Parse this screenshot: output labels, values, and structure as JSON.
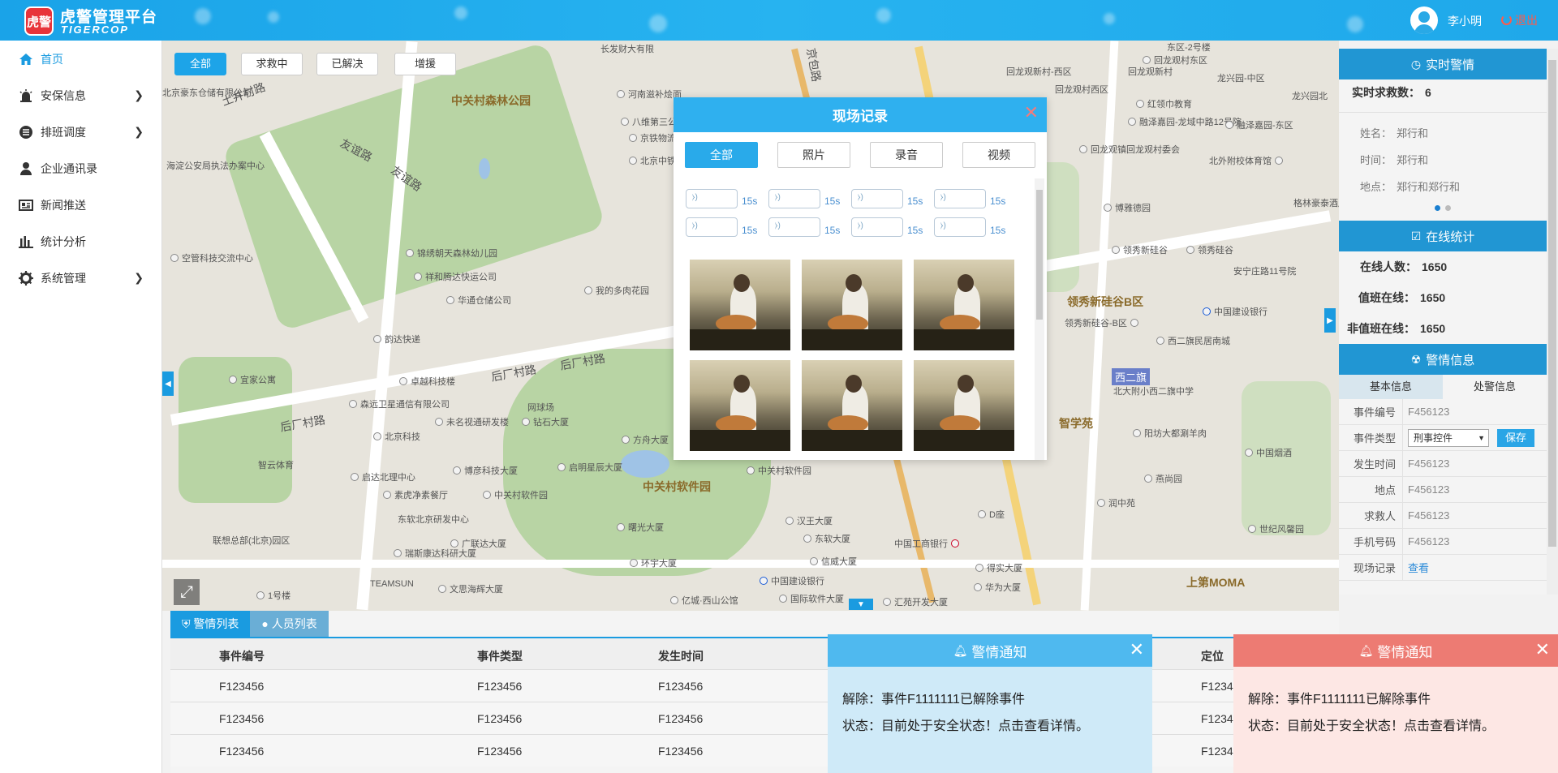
{
  "header": {
    "logo_text": "虎警",
    "title": "虎警管理平台",
    "subtitle": "TIGERCOP",
    "user_name": "李小明",
    "logout_label": "退出"
  },
  "sidebar": {
    "items": [
      {
        "label": "首页",
        "icon": "home-icon"
      },
      {
        "label": "安保信息",
        "icon": "siren-icon"
      },
      {
        "label": "排班调度",
        "icon": "schedule-icon"
      },
      {
        "label": "企业通讯录",
        "icon": "user-icon"
      },
      {
        "label": "新闻推送",
        "icon": "news-icon"
      },
      {
        "label": "统计分析",
        "icon": "bar-chart-icon"
      },
      {
        "label": "系统管理",
        "icon": "gear-icon"
      }
    ]
  },
  "map": {
    "filters": [
      "全部",
      "求救中",
      "已解决",
      "增援"
    ],
    "labels": {
      "l1": "中关村森林公园",
      "l2": "中关村软件园",
      "l3": "领秀新硅谷B区",
      "l4": "智学苑",
      "l5": "上第MOMA",
      "l6": "友谊路",
      "l7": "后厂村路",
      "l8": "西二旗",
      "l9": "河南滋补烩面",
      "l10": "八维第三公寓",
      "l11": "京铁物流有限公司",
      "l12": "北京中铁有限公司",
      "l13": "海淀公安局执法办案中心",
      "l14": "北京豪东仓储有限公司",
      "l15": "土井村路",
      "l16": "空管科技交流中心",
      "l17": "锦绣朝天森林幼儿园",
      "l18": "祥和腾达快运公司",
      "l19": "华通仓储公司",
      "l20": "我的多肉花园",
      "l21": "韵达快递",
      "l22": "宜家公寓",
      "l23": "卓越科技楼",
      "l24": "森远卫星通信有限公司",
      "l25": "北京科技",
      "l26": "未名视通研发楼",
      "l27": "钻石大厦",
      "l28": "网球场",
      "l29": "方舟大厦",
      "l30": "启明星辰大厦",
      "l31": "智云体育",
      "l32": "博彦科技大厦",
      "l33": "启达北理中心",
      "l34": "中关村软件园",
      "l35": "素虎净素餐厅",
      "l36": "东软北京研发中心",
      "l37": "广联达大厦",
      "l38": "联想总部(北京)园区",
      "l39": "瑞斯康达科研大厦",
      "l40": "TEAMSUN",
      "l41": "文思海辉大厦",
      "l42": "1号楼",
      "l43": "曙光大厦",
      "l44": "环宇大厦",
      "l45": "亿城·西山公馆",
      "l46": "中关村软件园",
      "l47": "汉王大厦",
      "l48": "东软大厦",
      "l49": "信威大厦",
      "l50": "中国建设银行",
      "l51": "国际软件大厦",
      "l52": "汇苑开发大厦",
      "l53": "中国工商银行",
      "l54": "D座",
      "l55": "得实大厦",
      "l56": "华为大厦",
      "l57": "回龙观新村-西区",
      "l58": "回龙观新村",
      "l59": "回龙观村西区",
      "l60": "回龙观村东区",
      "l61": "红领巾教育",
      "l62": "融泽嘉园-龙域中路12号院",
      "l63": "融泽嘉园-东区",
      "l64": "回龙观镇回龙观村委会",
      "l65": "北外附校体育馆",
      "l66": "博雅德园",
      "l67": "领秀新硅谷",
      "l68": "领秀硅谷",
      "l69": "安宁庄路11号院",
      "l70": "领秀新硅谷-B区",
      "l71": "中国建设银行",
      "l72": "西二旗民居南城",
      "l73": "北大附小西二旗中学",
      "l74": "阳坊大都涮羊肉",
      "l75": "中国烟酒",
      "l76": "燕尚园",
      "l77": "润中苑",
      "l78": "世纪风馨园",
      "l79": "龙兴园-中区",
      "l80": "龙兴园北",
      "l81": "格林豪泰酒店",
      "l82": "北京豪东",
      "l83": "友谊路",
      "l84": "后厂村路",
      "l85": "长发财大有限",
      "l86": "东区-2号楼",
      "l87": "京包路"
    }
  },
  "realtime": {
    "title": "实时警情",
    "count_label": "实时求救数：",
    "count": "6",
    "name_label": "姓名：",
    "name": "郑行和",
    "time_label": "时间：",
    "time": "郑行和",
    "place_label": "地点：",
    "place": "郑行和郑行和"
  },
  "online": {
    "title": "在线统计",
    "online_label": "在线人数：",
    "online": "1650",
    "duty_label": "值班在线：",
    "duty": "1650",
    "offduty_label": "非值班在线：",
    "offduty": "1650"
  },
  "alarm_info": {
    "title": "警情信息",
    "tab_basic": "基本信息",
    "tab_handle": "处警信息",
    "rows": [
      {
        "k": "事件编号",
        "v": "F456123"
      },
      {
        "k": "发生时间",
        "v": "F456123"
      },
      {
        "k": "地点",
        "v": "F456123"
      },
      {
        "k": "求救人",
        "v": "F456123"
      },
      {
        "k": "手机号码",
        "v": "F456123"
      }
    ],
    "type_label": "事件类型",
    "type_value": "刑事控件",
    "save_label": "保存",
    "record_label": "现场记录",
    "record_link": "查看"
  },
  "bottom": {
    "tab_alarm": "警情列表",
    "tab_people": "人员列表",
    "columns": [
      "事件编号",
      "事件类型",
      "发生时间",
      "定位"
    ],
    "rows": [
      [
        "F123456",
        "F123456",
        "F123456",
        "F1234"
      ],
      [
        "F123456",
        "F123456",
        "F123456",
        "F1234"
      ],
      [
        "F123456",
        "F123456",
        "F123456",
        "F1234"
      ]
    ]
  },
  "notifications": [
    {
      "title": "警情通知",
      "line1": "解除：事件F1111111已解除事件",
      "line2": "状态：目前处于安全状态！点击查看详情。"
    },
    {
      "title": "警情通知",
      "line1": "解除：事件F1111111已解除事件",
      "line2": "状态：目前处于安全状态！点击查看详情。"
    }
  ],
  "modal": {
    "title": "现场记录",
    "tabs": [
      "全部",
      "照片",
      "录音",
      "视频"
    ],
    "audio_durations": [
      "15s",
      "15s",
      "15s",
      "15s",
      "15s",
      "15s",
      "15s",
      "15s"
    ]
  }
}
